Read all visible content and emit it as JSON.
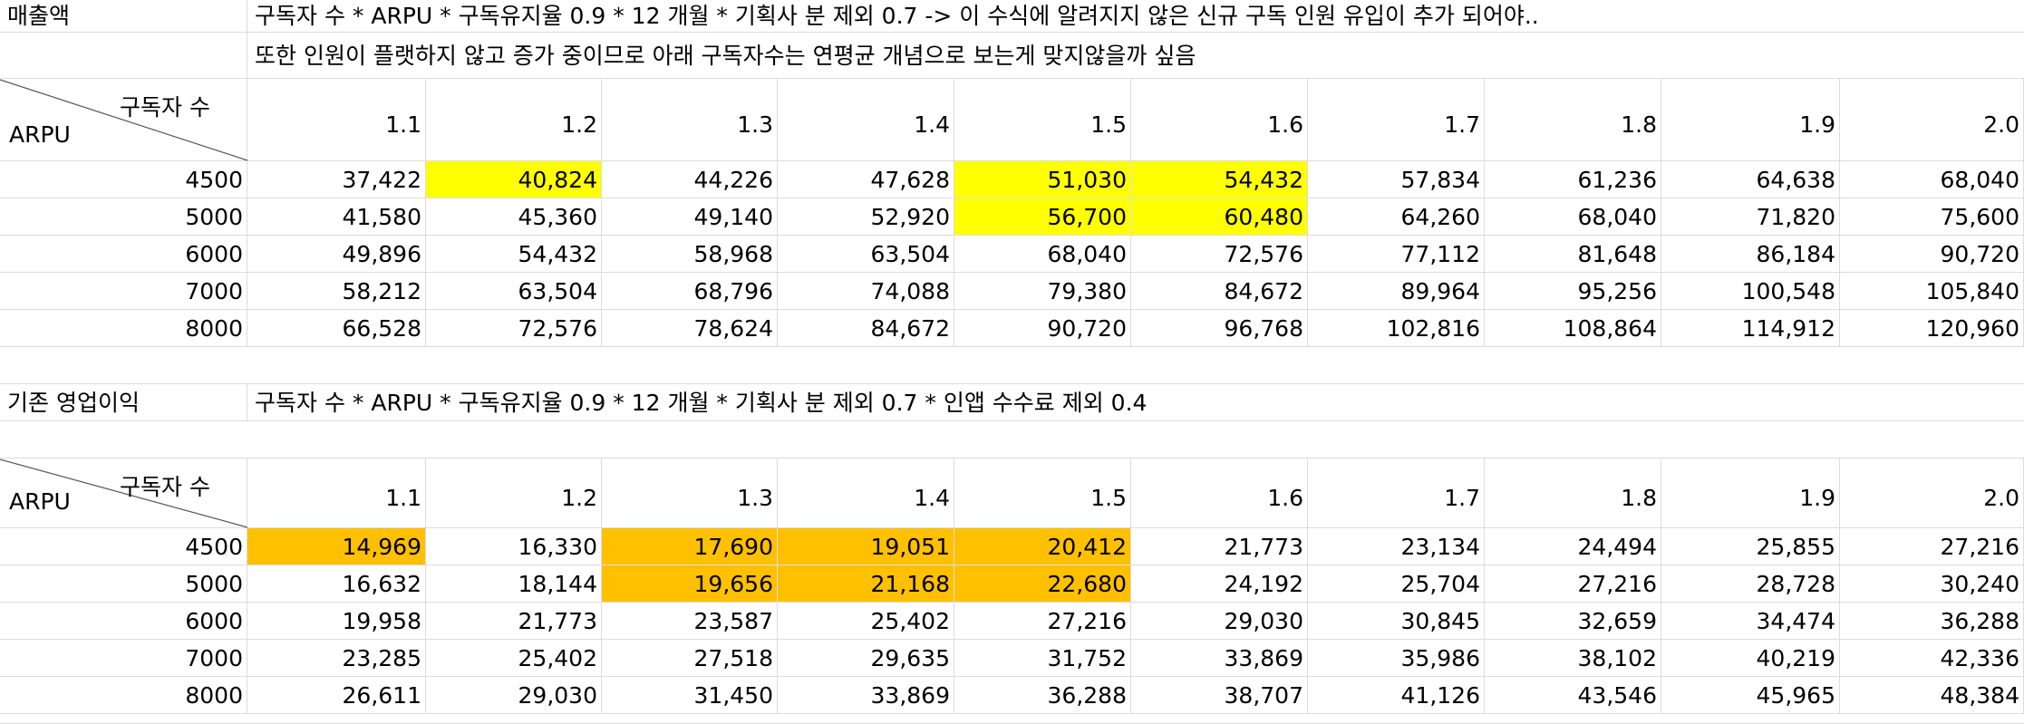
{
  "section1": {
    "title": "매출액",
    "formula": "구독자 수 * ARPU * 구독유지율 0.9 * 12 개월 * 기획사 분 제외 0.7 -> 이 수식에 알려지지 않은 신규 구독 인원 유입이 추가 되어야..",
    "note": "또한 인원이 플랫하지 않고 증가 중이므로 아래 구독자수는 연평균 개념으로 보는게 맞지않을까 싶음",
    "corner_top": "구독자 수",
    "corner_bottom": "ARPU",
    "headers": [
      "1.1",
      "1.2",
      "1.3",
      "1.4",
      "1.5",
      "1.6",
      "1.7",
      "1.8",
      "1.9",
      "2.0"
    ],
    "rows": [
      {
        "arpu": "4500",
        "values": [
          "37,422",
          "40,824",
          "44,226",
          "47,628",
          "51,030",
          "54,432",
          "57,834",
          "61,236",
          "64,638",
          "68,040"
        ]
      },
      {
        "arpu": "5000",
        "values": [
          "41,580",
          "45,360",
          "49,140",
          "52,920",
          "56,700",
          "60,480",
          "64,260",
          "68,040",
          "71,820",
          "75,600"
        ]
      },
      {
        "arpu": "6000",
        "values": [
          "49,896",
          "54,432",
          "58,968",
          "63,504",
          "68,040",
          "72,576",
          "77,112",
          "81,648",
          "86,184",
          "90,720"
        ]
      },
      {
        "arpu": "7000",
        "values": [
          "58,212",
          "63,504",
          "68,796",
          "74,088",
          "79,380",
          "84,672",
          "89,964",
          "95,256",
          "100,548",
          "105,840"
        ]
      },
      {
        "arpu": "8000",
        "values": [
          "66,528",
          "72,576",
          "78,624",
          "84,672",
          "90,720",
          "96,768",
          "102,816",
          "108,864",
          "114,912",
          "120,960"
        ]
      }
    ],
    "highlight_color": "#ffff00"
  },
  "section2": {
    "title": "기존 영업이익",
    "formula": "구독자 수 * ARPU * 구독유지율 0.9 * 12 개월 * 기획사 분 제외 0.7 * 인앱 수수료 제외 0.4",
    "corner_top": "구독자 수",
    "corner_bottom": "ARPU",
    "headers": [
      "1.1",
      "1.2",
      "1.3",
      "1.4",
      "1.5",
      "1.6",
      "1.7",
      "1.8",
      "1.9",
      "2.0"
    ],
    "rows": [
      {
        "arpu": "4500",
        "values": [
          "14,969",
          "16,330",
          "17,690",
          "19,051",
          "20,412",
          "21,773",
          "23,134",
          "24,494",
          "25,855",
          "27,216"
        ]
      },
      {
        "arpu": "5000",
        "values": [
          "16,632",
          "18,144",
          "19,656",
          "21,168",
          "22,680",
          "24,192",
          "25,704",
          "27,216",
          "28,728",
          "30,240"
        ]
      },
      {
        "arpu": "6000",
        "values": [
          "19,958",
          "21,773",
          "23,587",
          "25,402",
          "27,216",
          "29,030",
          "30,845",
          "32,659",
          "34,474",
          "36,288"
        ]
      },
      {
        "arpu": "7000",
        "values": [
          "23,285",
          "25,402",
          "27,518",
          "29,635",
          "31,752",
          "33,869",
          "35,986",
          "38,102",
          "40,219",
          "42,336"
        ]
      },
      {
        "arpu": "8000",
        "values": [
          "26,611",
          "29,030",
          "31,450",
          "33,869",
          "36,288",
          "38,707",
          "41,126",
          "43,546",
          "45,965",
          "48,384"
        ]
      }
    ],
    "highlight_color": "#ffc000"
  }
}
